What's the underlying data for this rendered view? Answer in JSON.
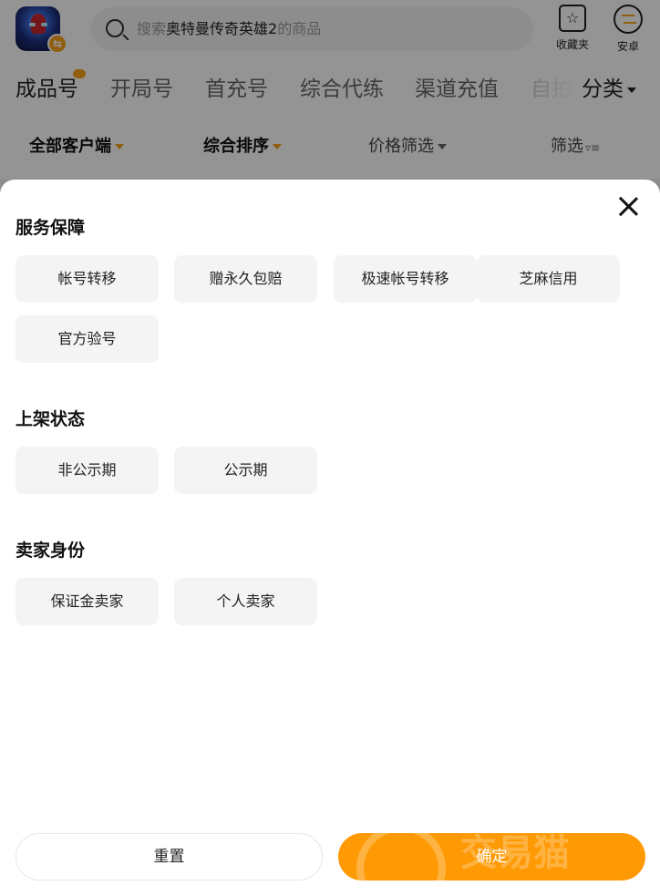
{
  "header": {
    "search_prefix": "搜索",
    "search_highlight": "奥特曼传奇英雄2",
    "search_suffix": "的商品",
    "favorites_label": "收藏夹",
    "android_label": "安卓",
    "icons": {
      "app": "game-app-icon",
      "search": "search-icon",
      "favorites": "star-icon",
      "platform": "swap-arrows-icon"
    }
  },
  "category_tabs": {
    "items": [
      "成品号",
      "开局号",
      "首充号",
      "综合代练",
      "渠道充值",
      "自拍"
    ],
    "more_label": "分类"
  },
  "sort_bar": {
    "client": "全部客户端",
    "sort": "综合排序",
    "price": "价格筛选",
    "filter": "筛选"
  },
  "filter_sheet": {
    "sections": [
      {
        "title": "服务保障",
        "options": [
          "帐号转移",
          "赠永久包赔",
          "极速帐号转移",
          "芝麻信用",
          "官方验号"
        ]
      },
      {
        "title": "上架状态",
        "options": [
          "非公示期",
          "公示期"
        ]
      },
      {
        "title": "卖家身份",
        "options": [
          "保证金卖家",
          "个人卖家"
        ]
      }
    ],
    "reset_label": "重置",
    "confirm_label": "确定",
    "confirm_watermark": "交易猫",
    "accent_color": "#ff9a05"
  }
}
